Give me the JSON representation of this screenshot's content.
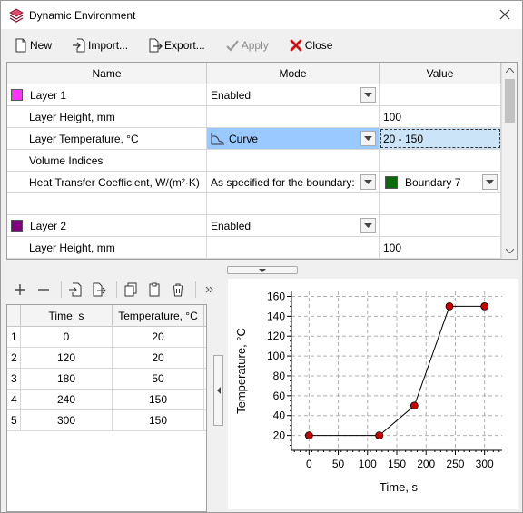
{
  "window": {
    "title": "Dynamic Environment",
    "icon": "layers-icon"
  },
  "toolbar": {
    "new_label": "New",
    "import_label": "Import...",
    "export_label": "Export...",
    "apply_label": "Apply",
    "close_label": "Close"
  },
  "grid": {
    "headers": {
      "name": "Name",
      "mode": "Mode",
      "value": "Value"
    },
    "rows": [
      {
        "name": "Layer 1",
        "mode": "Enabled",
        "value": "",
        "swatch": "#ff33ff"
      },
      {
        "name": "Layer Height, mm",
        "mode": "",
        "value": "100"
      },
      {
        "name": "Layer Temperature, °C",
        "mode": "Curve",
        "value": "20 - 150"
      },
      {
        "name": "Volume Indices",
        "mode": "",
        "value": ""
      },
      {
        "name": "Heat Transfer Coefficient, W/(m²·K)",
        "mode": "As specified for the boundary:",
        "value": "Boundary 7",
        "value_swatch": "#0b6b0b"
      },
      {
        "name": "",
        "mode": "",
        "value": ""
      },
      {
        "name": "Layer 2",
        "mode": "Enabled",
        "value": "",
        "swatch": "#800080"
      },
      {
        "name": "Layer Height, mm",
        "mode": "",
        "value": "100"
      }
    ]
  },
  "points": {
    "headers": {
      "time": "Time, s",
      "temp": "Temperature, °C"
    },
    "rows": [
      {
        "idx": "1",
        "time": "0",
        "temp": "20"
      },
      {
        "idx": "2",
        "time": "120",
        "temp": "20"
      },
      {
        "idx": "3",
        "time": "180",
        "temp": "50"
      },
      {
        "idx": "4",
        "time": "240",
        "temp": "150"
      },
      {
        "idx": "5",
        "time": "300",
        "temp": "150"
      }
    ]
  },
  "chart_data": {
    "type": "line",
    "x": [
      0,
      120,
      180,
      240,
      300
    ],
    "series": [
      {
        "values": [
          20,
          20,
          50,
          150,
          150
        ]
      }
    ],
    "xlabel": "Time, s",
    "ylabel": "Temperature, °C",
    "xlim": [
      -30,
      330
    ],
    "ylim": [
      5,
      165
    ],
    "xticks": [
      0,
      50,
      100,
      150,
      200,
      250,
      300
    ],
    "yticks": [
      20,
      40,
      60,
      80,
      100,
      120,
      140,
      160
    ],
    "grid": true,
    "marker_color": "#cc0000"
  }
}
